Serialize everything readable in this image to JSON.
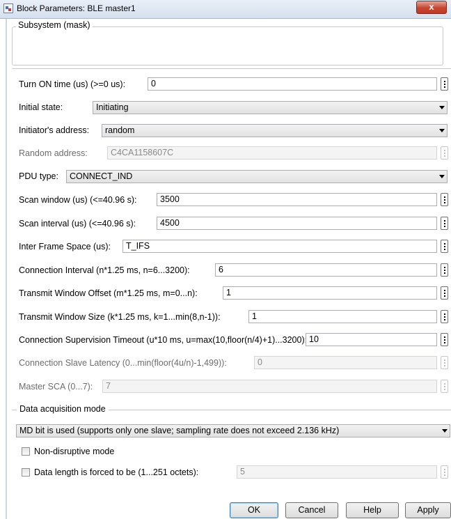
{
  "window": {
    "title": "Block Parameters: BLE master1",
    "close_glyph": "x"
  },
  "mask_group": {
    "label": "Subsystem (mask)"
  },
  "params": {
    "turn_on_time": {
      "label": "Turn ON time (us) (>=0 us):",
      "value": "0"
    },
    "initial_state": {
      "label": "Initial state:",
      "value": "Initiating"
    },
    "initiator_address": {
      "label": "Initiator's address:",
      "value": "random"
    },
    "random_address": {
      "label": "Random address:",
      "value": "C4CA1158607C"
    },
    "pdu_type": {
      "label": "PDU type:",
      "value": "CONNECT_IND"
    },
    "scan_window": {
      "label": "Scan window (us) (<=40.96 s):",
      "value": "3500"
    },
    "scan_interval": {
      "label": "Scan interval (us) (<=40.96 s):",
      "value": "4500"
    },
    "inter_frame_space": {
      "label": "Inter Frame Space (us):",
      "value": "T_IFS"
    },
    "connection_interval": {
      "label": "Connection Interval (n*1.25 ms, n=6...3200):",
      "value": "6"
    },
    "transmit_window_offset": {
      "label": "Transmit Window Offset (m*1.25 ms, m=0...n):",
      "value": "1"
    },
    "transmit_window_size": {
      "label": "Transmit Window Size (k*1.25 ms, k=1...min(8,n-1)):",
      "value": "1"
    },
    "supervision_timeout": {
      "label": "Connection Supervision Timeout (u*10 ms, u=max(10,floor(n/4)+1)...3200):",
      "value": "10"
    },
    "slave_latency": {
      "label": "Connection Slave Latency (0...min(floor(4u/n)-1,499)):",
      "value": "0"
    },
    "master_sca": {
      "label": "Master SCA (0...7):",
      "value": "7"
    }
  },
  "data_acquisition": {
    "label": "Data acquisition mode",
    "mode_value": "MD bit is used (supports only one slave; sampling rate does not exceed 2.136 kHz)",
    "non_disruptive": {
      "label": "Non-disruptive mode",
      "checked": false
    },
    "data_length_forced": {
      "label": "Data length is forced to be (1...251 octets):",
      "checked": false,
      "value": "5"
    }
  },
  "buttons": {
    "ok": "OK",
    "cancel": "Cancel",
    "help": "Help",
    "apply": "Apply"
  },
  "icons": {
    "window": "simulink-block-icon",
    "close": "close-icon",
    "dropdown": "chevron-down-icon",
    "more": "vertical-dots-icon"
  }
}
